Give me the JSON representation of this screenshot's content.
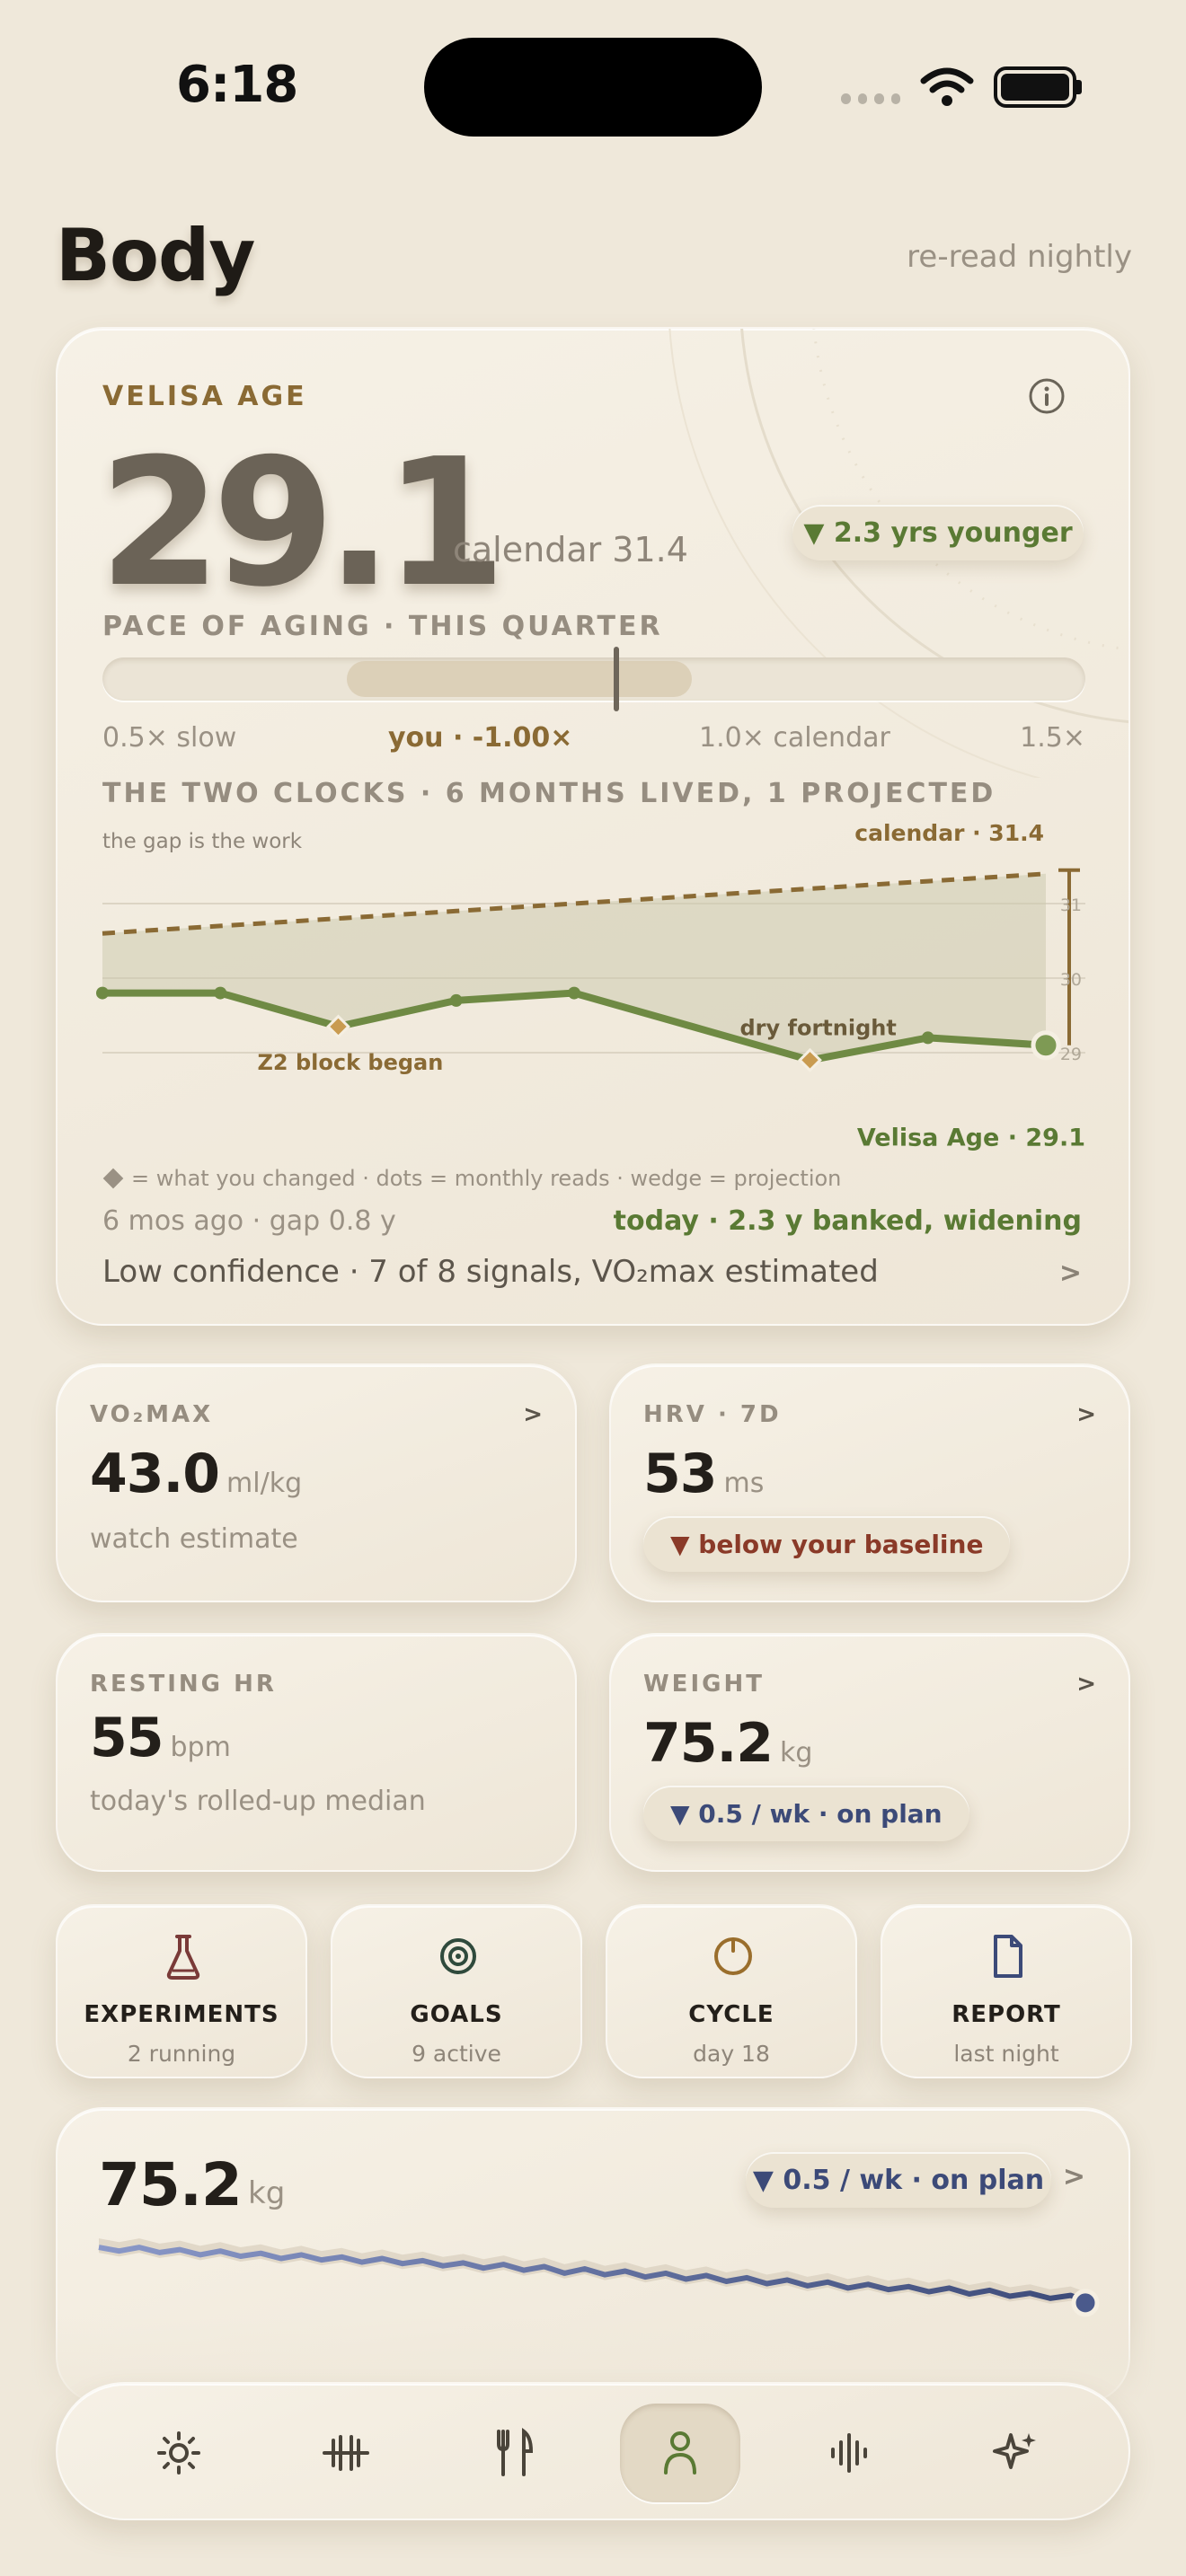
{
  "status": {
    "time": "6:18"
  },
  "header": {
    "title": "Body",
    "subtitle": "re-read nightly"
  },
  "age_card": {
    "label": "VELISA AGE",
    "value": "29.1",
    "calendar": "calendar 31.4",
    "delta": "▼ 2.3 yrs younger",
    "pace_label": "PACE OF AGING · THIS QUARTER",
    "pace_ticks": {
      "slow": "0.5× slow",
      "you": "you · -1.00×",
      "calendar": "1.0× calendar",
      "fast": "1.5×"
    },
    "pace_value": -1.0,
    "clocks_label": "THE TWO CLOCKS · 6 MONTHS LIVED, 1 PROJECTED",
    "gap_note": "the gap is the work",
    "calendar_tag": "calendar · 31.4",
    "velisa_tag": "Velisa Age · 29.1",
    "annotations": {
      "z2": "Z2 block began",
      "dry": "dry fortnight"
    },
    "y_ticks": [
      "31",
      "30",
      "29"
    ],
    "legend": "= what you changed · dots = monthly reads · wedge = projection",
    "gap_left": "6 mos ago · gap 0.8 y",
    "gap_right": "today · 2.3 y banked, widening",
    "confidence": "Low confidence · 7 of 8 signals, VO₂max estimated",
    "confidence_chevron": ">"
  },
  "chart_data": {
    "type": "line",
    "title": "THE TWO CLOCKS · 6 MONTHS LIVED, 1 PROJECTED",
    "ylim": [
      28.8,
      31.5
    ],
    "y_ticks": [
      31,
      30,
      29
    ],
    "series": [
      {
        "name": "calendar",
        "values": [
          30.6,
          30.7,
          30.8,
          30.9,
          31.0,
          31.1,
          31.2,
          31.3,
          31.4
        ]
      },
      {
        "name": "Velisa Age",
        "values": [
          29.8,
          29.8,
          29.35,
          29.7,
          29.8,
          29.35,
          28.9,
          29.2,
          29.1
        ]
      }
    ],
    "changes": [
      {
        "label": "Z2 block began"
      },
      {
        "label": "dry fortnight"
      }
    ]
  },
  "metrics": [
    {
      "label": "VO₂MAX",
      "value": "43.0",
      "unit": "ml/kg",
      "note": "watch estimate",
      "chevron": ">"
    },
    {
      "label": "HRV · 7D",
      "value": "53",
      "unit": "ms",
      "pill": "▼ below your baseline",
      "chevron": ">",
      "pill_color": "#8a3a28"
    },
    {
      "label": "RESTING HR",
      "value": "55",
      "unit": "bpm",
      "note": "today's rolled-up median"
    },
    {
      "label": "WEIGHT",
      "value": "75.2",
      "unit": "kg",
      "pill": "▼ 0.5 / wk · on plan",
      "chevron": ">",
      "pill_color": "#3c4a78"
    }
  ],
  "tiles": [
    {
      "title": "EXPERIMENTS",
      "sub": "2 running",
      "icon": "flask-icon"
    },
    {
      "title": "GOALS",
      "sub": "9 active",
      "icon": "target-icon"
    },
    {
      "title": "CYCLE",
      "sub": "day 18",
      "icon": "cycle-icon"
    },
    {
      "title": "REPORT",
      "sub": "last night",
      "icon": "document-icon"
    }
  ],
  "weight_card": {
    "value": "75.2",
    "unit": "kg",
    "pill": "▼ 0.5 / wk · on plan",
    "chevron": ">"
  },
  "weight_chart_data": {
    "type": "line",
    "values": [
      75.95,
      75.9,
      75.95,
      75.88,
      75.92,
      75.85,
      75.9,
      75.83,
      75.87,
      75.8,
      75.85,
      75.78,
      75.82,
      75.75,
      75.8,
      75.73,
      75.77,
      75.7,
      75.74,
      75.67,
      75.72,
      75.64,
      75.69,
      75.6,
      75.66,
      75.58,
      75.63,
      75.55,
      75.6,
      75.52,
      75.57,
      75.49,
      75.54,
      75.46,
      75.51,
      75.43,
      75.48,
      75.4,
      75.45,
      75.38,
      75.42,
      75.35,
      75.4,
      75.32,
      75.37,
      75.29,
      75.33,
      75.26,
      75.3,
      75.2
    ]
  },
  "tabbar": {
    "tabs": [
      "sun-icon",
      "barbell-icon",
      "fork-knife-icon",
      "person-icon",
      "waveform-icon",
      "sparkle-icon"
    ],
    "active": 3
  },
  "colors": {
    "accent_gold": "#8a6a34",
    "green": "#5a7a34",
    "navy": "#3c4a78",
    "background": "#efe8da"
  }
}
